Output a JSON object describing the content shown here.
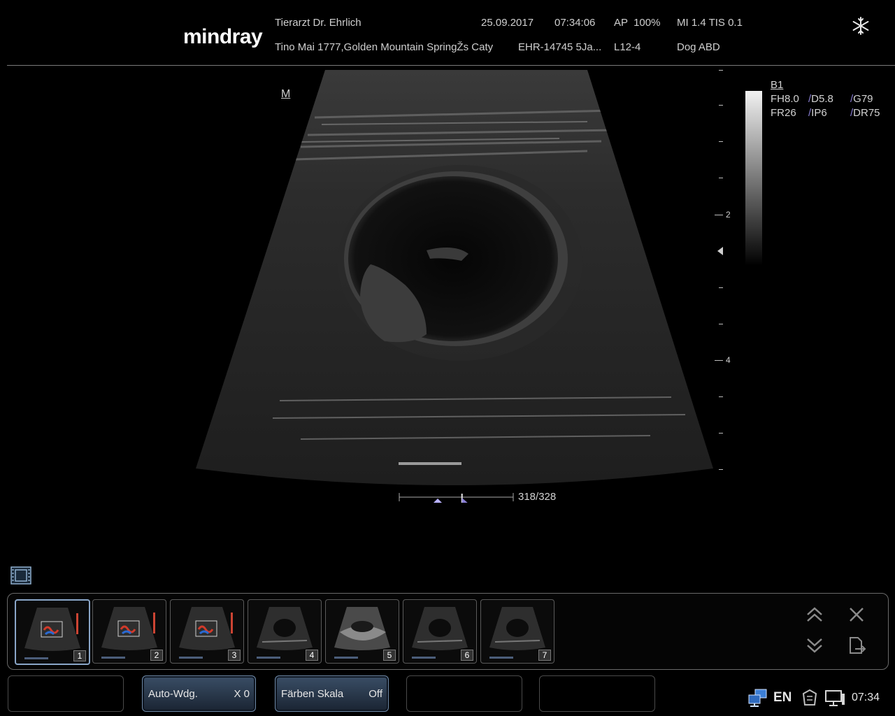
{
  "header": {
    "logo": "mindray",
    "clinic": "Tierarzt Dr. Ehrlich",
    "date": "25.09.2017",
    "time": "07:34:06",
    "ap": "AP  100%",
    "mi_tis": "MI 1.4 TIS 0.1",
    "address": "Tino Mai 1777,Golden Mountain SpringŽs Caty",
    "patient_id": "EHR-14745 5Ja...",
    "probe": "L12-4",
    "exam": "Dog ABD",
    "freeze_icon": "snowflake-icon"
  },
  "image": {
    "orientation_mark": "M",
    "depth_labels": [
      "2",
      "4"
    ]
  },
  "params": {
    "title": "B1",
    "row1": [
      "FH8.0",
      "D5.8",
      "G79"
    ],
    "row2": [
      "FR26",
      "IP6",
      "DR75"
    ]
  },
  "cine": {
    "frame_counter": "318/328",
    "position_fraction": 0.55
  },
  "thumbnails": [
    {
      "num": "1",
      "type": "color",
      "selected": true
    },
    {
      "num": "2",
      "type": "color",
      "selected": false
    },
    {
      "num": "3",
      "type": "color",
      "selected": false
    },
    {
      "num": "4",
      "type": "bmode",
      "selected": false
    },
    {
      "num": "5",
      "type": "bmode-bright",
      "selected": false
    },
    {
      "num": "6",
      "type": "bmode",
      "selected": false
    },
    {
      "num": "7",
      "type": "bmode",
      "selected": false
    }
  ],
  "buttons": [
    {
      "label": "",
      "value": "",
      "active": false
    },
    {
      "label": "Auto-Wdg.",
      "value": "X 0",
      "active": true
    },
    {
      "label": "Färben Skala",
      "value": "Off",
      "active": true
    },
    {
      "label": "",
      "value": "",
      "active": false
    },
    {
      "label": "",
      "value": "",
      "active": false
    }
  ],
  "tray": {
    "language": "EN",
    "clock": "07:34",
    "icons": [
      "network-icon",
      "printer-icon",
      "display-icon"
    ]
  }
}
